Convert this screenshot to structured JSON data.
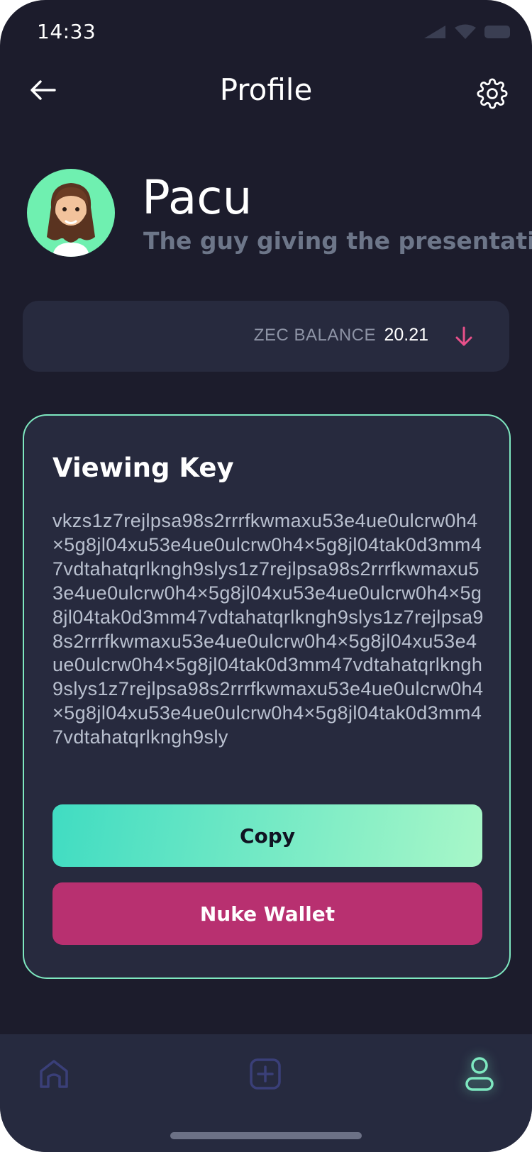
{
  "status_bar": {
    "time": "14:33"
  },
  "header": {
    "title": "Profile"
  },
  "profile": {
    "name": "Pacu",
    "bio": "The guy giving the presentation"
  },
  "balance": {
    "label": "ZEC BALANCE",
    "value": "20.21"
  },
  "viewing_key": {
    "title": "Viewing Key",
    "key": "vkzs1z7rejlpsa98s2rrrfkwmaxu53e4ue0ulcrw0h4×5g8jl04xu53e4ue0ulcrw0h4×5g8jl04tak0d3mm47vdtahatqrlkngh9slys1z7rejlpsa98s2rrrfkwmaxu53e4ue0ulcrw0h4×5g8jl04xu53e4ue0ulcrw0h4×5g8jl04tak0d3mm47vdtahatqrlkngh9slys1z7rejlpsa98s2rrrfkwmaxu53e4ue0ulcrw0h4×5g8jl04xu53e4ue0ulcrw0h4×5g8jl04tak0d3mm47vdtahatqrlkngh9slys1z7rejlpsa98s2rrrfkwmaxu53e4ue0ulcrw0h4×5g8jl04xu53e4ue0ulcrw0h4×5g8jl04tak0d3mm47vdtahatqrlkngh9sly",
    "copy_label": "Copy",
    "nuke_label": "Nuke Wallet"
  },
  "bottom_nav": {
    "items": [
      {
        "icon": "home-icon",
        "active": false
      },
      {
        "icon": "plus-square-icon",
        "active": false
      },
      {
        "icon": "user-icon",
        "active": true
      }
    ]
  },
  "colors": {
    "background": "#1c1c2c",
    "card": "#272a3e",
    "accent_green": "#7ee8c0",
    "accent_pink": "#b83070",
    "arrow_pink": "#e8508a",
    "muted_text": "#6d7689"
  }
}
